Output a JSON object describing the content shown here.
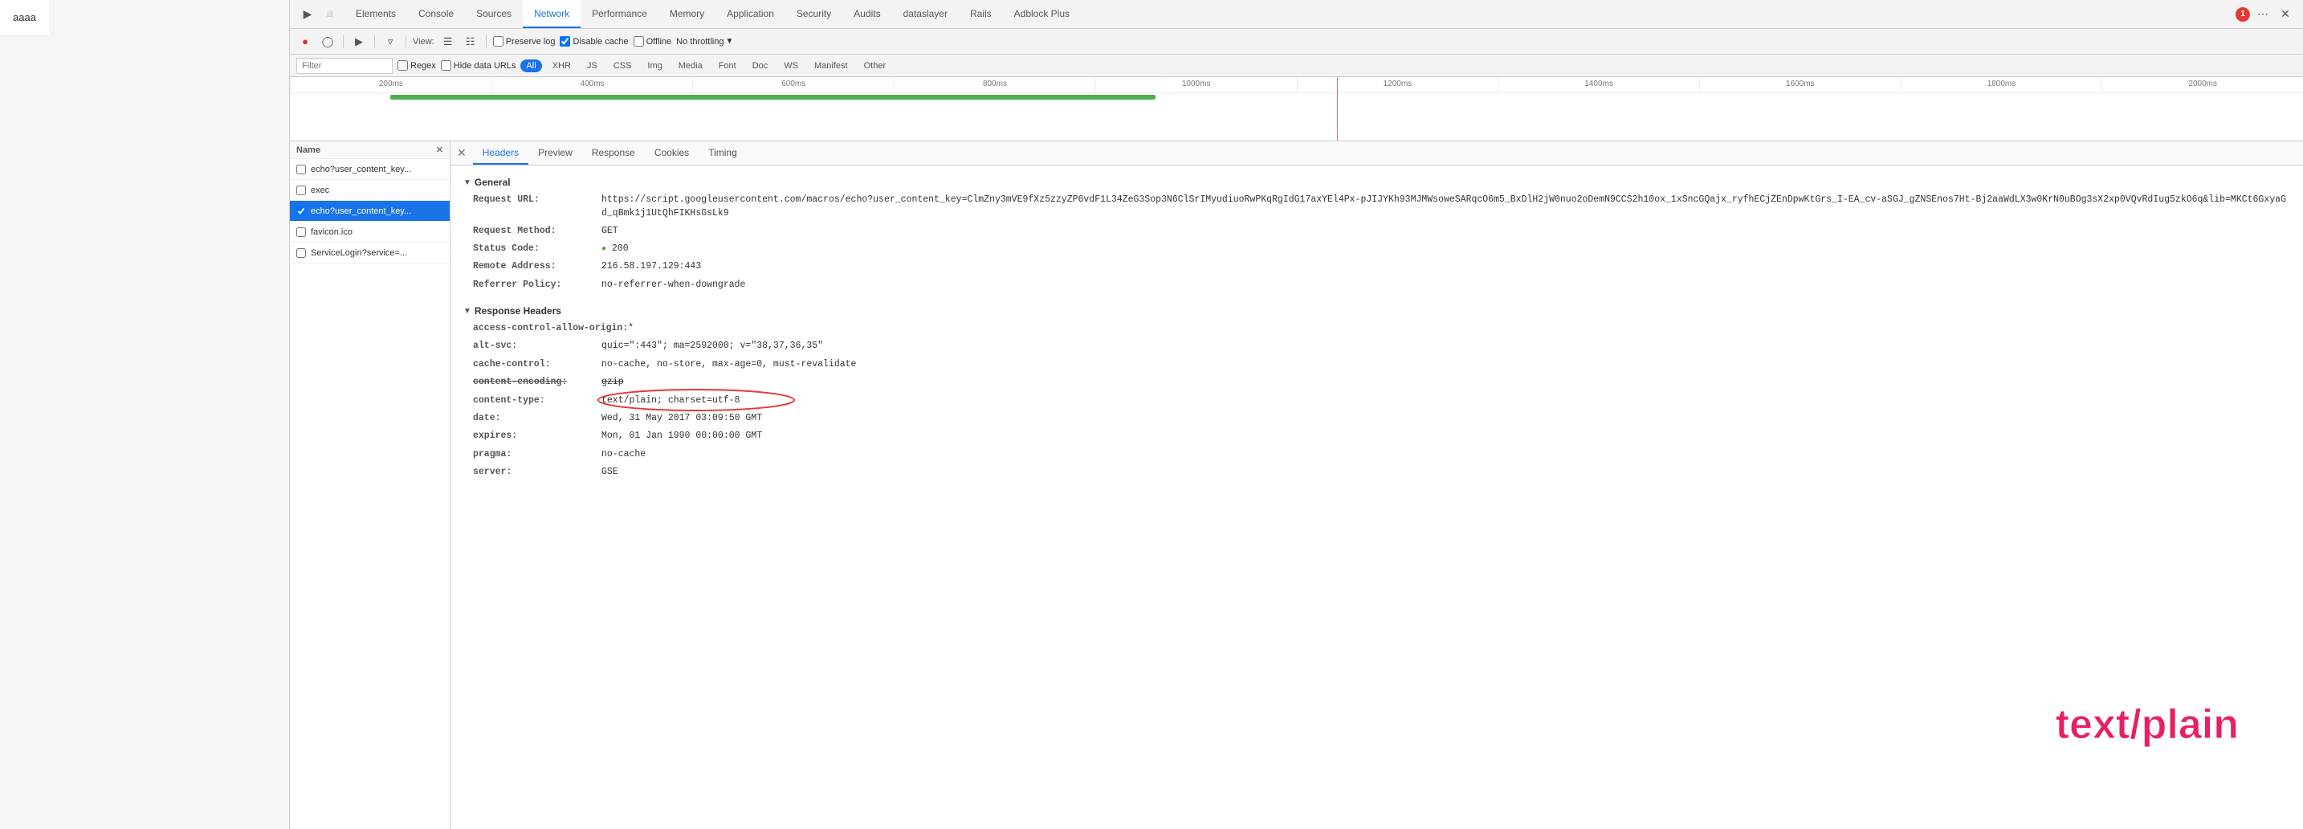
{
  "page": {
    "title": "aaaa"
  },
  "devtools": {
    "tabs": [
      {
        "id": "elements",
        "label": "Elements",
        "active": false
      },
      {
        "id": "console",
        "label": "Console",
        "active": false
      },
      {
        "id": "sources",
        "label": "Sources",
        "active": false
      },
      {
        "id": "network",
        "label": "Network",
        "active": true
      },
      {
        "id": "performance",
        "label": "Performance",
        "active": false
      },
      {
        "id": "memory",
        "label": "Memory",
        "active": false
      },
      {
        "id": "application",
        "label": "Application",
        "active": false
      },
      {
        "id": "security",
        "label": "Security",
        "active": false
      },
      {
        "id": "audits",
        "label": "Audits",
        "active": false
      },
      {
        "id": "datalayer",
        "label": "dataslayer",
        "active": false
      },
      {
        "id": "rails",
        "label": "Rails",
        "active": false
      },
      {
        "id": "adblock",
        "label": "Adblock Plus",
        "active": false
      }
    ],
    "toolbar": {
      "preserve_log_label": "Preserve log",
      "disable_cache_label": "Disable cache",
      "offline_label": "Offline",
      "throttling_label": "No throttling",
      "view_label": "View:"
    },
    "filter": {
      "placeholder": "Filter",
      "regex_label": "Regex",
      "hide_data_label": "Hide data URLs",
      "type_buttons": [
        "All",
        "XHR",
        "JS",
        "CSS",
        "Img",
        "Media",
        "Font",
        "Doc",
        "WS",
        "Manifest",
        "Other"
      ]
    },
    "timeline": {
      "ticks": [
        "200ms",
        "400ms",
        "600ms",
        "800ms",
        "1000ms",
        "1200ms",
        "1400ms",
        "1600ms",
        "1800ms",
        "2000ms"
      ]
    },
    "file_list": {
      "column_header": "Name",
      "files": [
        {
          "name": "echo?user_content_key...",
          "selected": false,
          "id": "file1"
        },
        {
          "name": "exec",
          "selected": false,
          "id": "file2"
        },
        {
          "name": "echo?user_content_key...",
          "selected": true,
          "id": "file3"
        },
        {
          "name": "favicon.ico",
          "selected": false,
          "id": "file4"
        },
        {
          "name": "ServiceLogin?service=...",
          "selected": false,
          "id": "file5"
        }
      ]
    },
    "detail": {
      "sub_tabs": [
        "Headers",
        "Preview",
        "Response",
        "Cookies",
        "Timing"
      ],
      "active_sub_tab": "Headers",
      "general_section": {
        "title": "General",
        "request_url_label": "Request URL:",
        "request_url_val": "https://script.googleusercontent.com/macros/echo?user_content_key=ClmZny3mVE9fXz5zzyZP6vdF1L34ZeG3Sop3N6ClSrIMyudiuoRwPKqRgIdG17axYEl4Px-pJIJYKh93MJMWsoweSARqcO6m5_BxDlH2jW0nuo2oDemN9CCS2h10ox_1xSncGQajx_ryfhECjZEnDpwKtGrs_I-EA_cv-aSGJ_gZNSEnos7Ht-Bj2aaWdLX3w0KrN0uBOg3sX2xp0VQvRdIug5zkO6q&lib=MKCt6GxyaGd_qBmk1j1UtQhFIKHsGsLk9",
        "request_method_label": "Request Method:",
        "request_method_val": "GET",
        "status_code_label": "Status Code:",
        "status_code_val": "200",
        "remote_address_label": "Remote Address:",
        "remote_address_val": "216.58.197.129:443",
        "referrer_policy_label": "Referrer Policy:",
        "referrer_policy_val": "no-referrer-when-downgrade"
      },
      "response_headers_section": {
        "title": "Response Headers",
        "headers": [
          {
            "key": "access-control-allow-origin:",
            "val": "*"
          },
          {
            "key": "alt-svc:",
            "val": "quic=\":443\"; ma=2592000; v=\"38,37,36,35\""
          },
          {
            "key": "cache-control:",
            "val": "no-cache, no-store, max-age=0, must-revalidate"
          },
          {
            "key": "content-encoding:",
            "val": "gzip",
            "strikethrough": true
          },
          {
            "key": "content-type:",
            "val": "text/plain; charset=utf-8",
            "highlighted": true
          },
          {
            "key": "date:",
            "val": "Wed, 31 May 2017 03:09:50 GMT"
          },
          {
            "key": "expires:",
            "val": "Mon, 01 Jan 1990 00:00:00 GMT"
          },
          {
            "key": "pragma:",
            "val": "no-cache"
          },
          {
            "key": "server:",
            "val": "GSE"
          }
        ]
      },
      "big_annotation": "text/plain"
    }
  },
  "error_badge": "1"
}
